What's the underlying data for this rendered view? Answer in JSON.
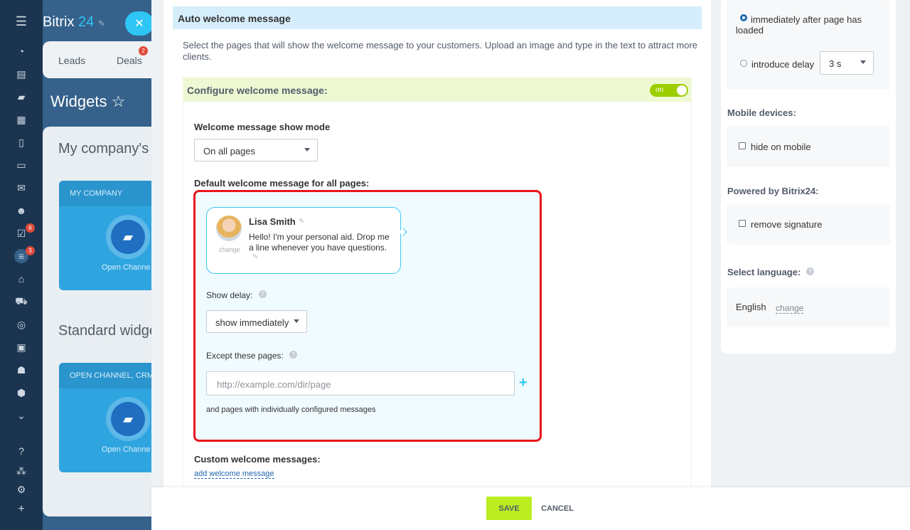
{
  "background": {
    "logo": {
      "name": "Bitrix",
      "suffix": "24"
    },
    "close_icon": "close-icon",
    "tabs": [
      {
        "label": "Leads"
      },
      {
        "label": "Deals",
        "badge": "2"
      }
    ],
    "page_title": "Widgets ☆",
    "section_1": "My company's",
    "tile_1": {
      "head": "MY COMPANY",
      "label": "Open Channe"
    },
    "section_2": "Standard widge",
    "tile_2": {
      "head": "OPEN CHANNEL, CRM",
      "label": "Open Channe"
    },
    "rail_badges": {
      "tasks": "6",
      "filter": "3"
    }
  },
  "main": {
    "header": "Auto welcome message",
    "description": "Select the pages that will show the welcome message to your customers. Upload an image and type in the text to attract more clients.",
    "configure_title": "Configure welcome message:",
    "toggle_label": "on",
    "show_mode_label": "Welcome message show mode",
    "show_mode_value": "On all pages",
    "default_label": "Default welcome message for all pages:",
    "bubble": {
      "name": "Lisa Smith",
      "change": "change",
      "text": "Hello! I'm your personal aid. Drop me a line whenever you have questions."
    },
    "show_delay_label": "Show delay:",
    "show_delay_value": "show immediately",
    "except_label": "Except these pages:",
    "except_placeholder": "http://example.com/dir/page",
    "individual_note": "and pages with individually configured messages",
    "custom_label": "Custom welcome messages:",
    "add_link": "add welcome message"
  },
  "right": {
    "radio_immediately": "immediately after page has loaded",
    "radio_delay": "introduce delay",
    "delay_value": "3 s",
    "mobile_head": "Mobile devices:",
    "hide_mobile": "hide on mobile",
    "powered_head": "Powered by Bitrix24:",
    "remove_signature": "remove signature",
    "language_head": "Select language:",
    "language_value": "English",
    "language_change": "change"
  },
  "footer": {
    "save": "SAVE",
    "cancel": "CANCEL"
  },
  "colors": {
    "accent": "#2fc6f6",
    "save": "#bbed21",
    "toggle": "#9dcf00",
    "highlight": "#e8161c"
  }
}
